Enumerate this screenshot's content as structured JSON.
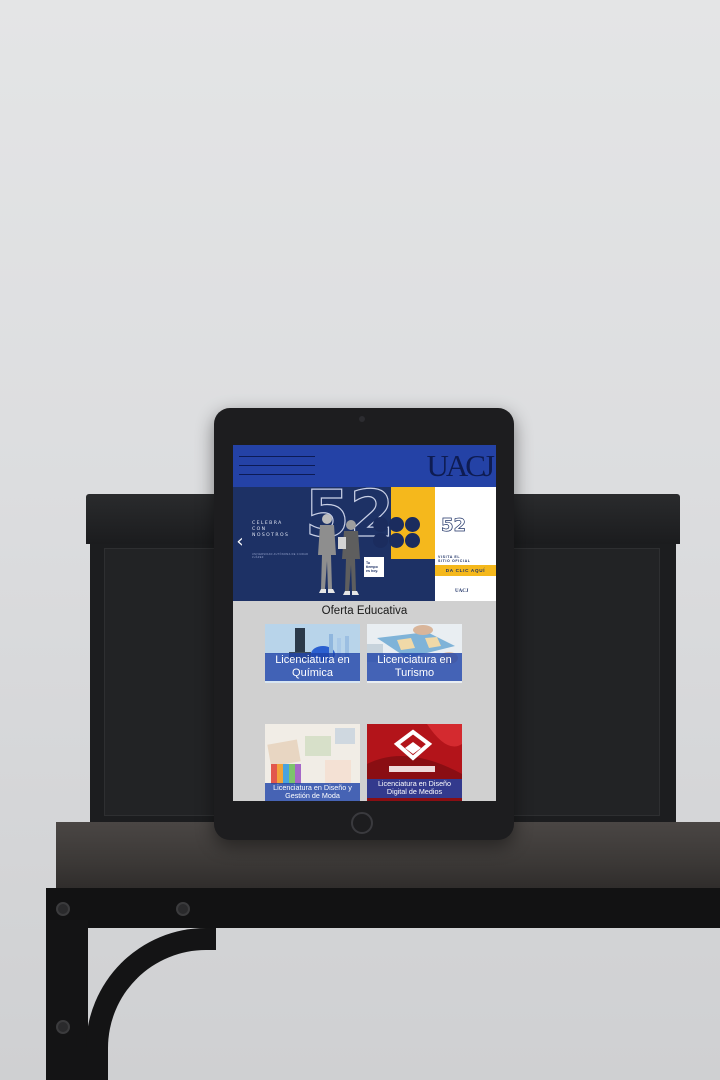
{
  "site": {
    "logo_text": "UACJ"
  },
  "carousel": {
    "prev_glyph": "‹",
    "next_glyph": "›",
    "kicker_lines": [
      "CELEBRA",
      "CON",
      "NOSOTROS"
    ],
    "fineprint": "UNIVERSIDAD AUTÓNOMA DE CIUDAD JUÁREZ",
    "big_number": "52",
    "sticker_lines": [
      "Tu",
      "tiempo",
      "es hoy."
    ],
    "panel_number": "52",
    "panel_visit_lines": [
      "VISITA EL",
      "SITIO OFICIAL"
    ],
    "panel_cta": "DA CLIC AQUÍ",
    "panel_logo": "UACJ"
  },
  "oferta": {
    "title": "Oferta Educativa",
    "cards": [
      {
        "label": "Licenciatura en Química",
        "photo": "laboratory-photo"
      },
      {
        "label": "Licenciatura en Turismo",
        "photo": "map-planning-photo"
      },
      {
        "label": "Licenciatura en Diseño y Gestión de Moda",
        "photo": "fashion-swatches-photo"
      },
      {
        "label": "Licenciatura en Diseño Digital de Medios",
        "photo": "ddm-logo-photo"
      }
    ]
  },
  "colors": {
    "header_blue": "#2442a6",
    "navy": "#1d3165",
    "accent_yellow": "#f5b81c",
    "card_label_blue": "#2044a8",
    "page_gray": "#d0d0d0"
  }
}
